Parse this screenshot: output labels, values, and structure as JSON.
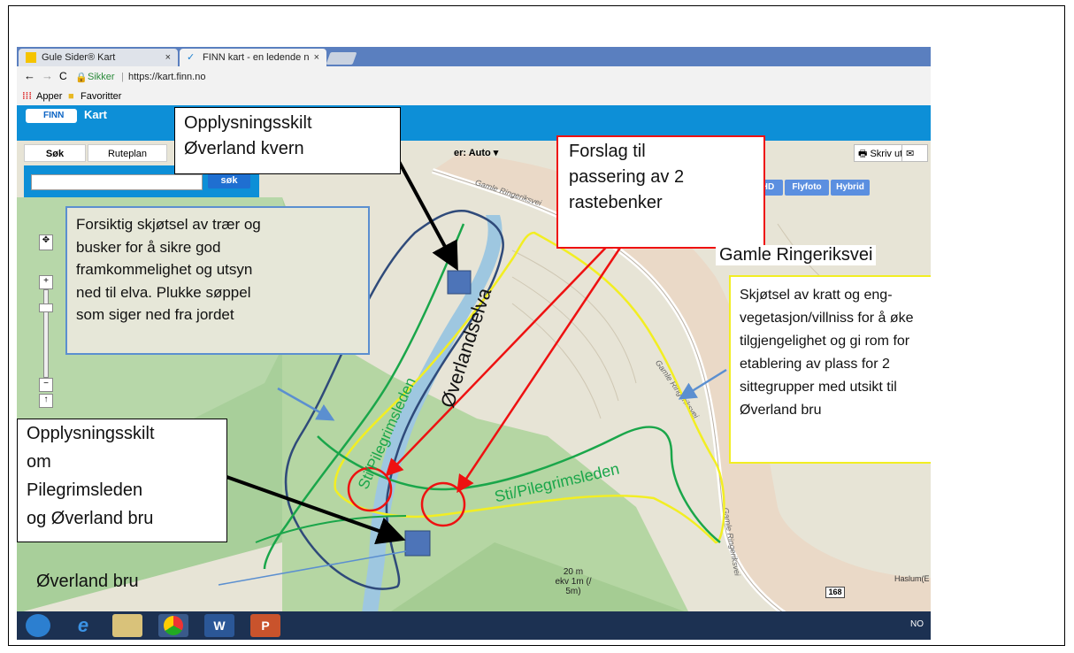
{
  "browser": {
    "tabs": [
      {
        "label": "Gule Sider® Kart",
        "close": "×"
      },
      {
        "label": "FINN kart - en ledende n",
        "close": "×"
      }
    ],
    "nav": {
      "back": "←",
      "forward": "→",
      "reload": "C"
    },
    "secure_label": "Sikker",
    "url": "https://kart.finn.no",
    "bookmarks": [
      "Apper",
      "Favoritter"
    ]
  },
  "finn": {
    "logo": "FINN",
    "title": "Kart",
    "menu": [
      "Søk",
      "Ruteplan"
    ],
    "map_mode_label": "er: Auto ▾",
    "print_label": "Skriv ut",
    "search_button": "søk",
    "map_types": [
      "HD",
      "Flyfoto",
      "Hybrid"
    ],
    "scale_text": [
      "20 m",
      "ekv 1m (/",
      "5m)"
    ],
    "place_label": "Haslum(E",
    "road_number": "168",
    "road_labels": [
      "Gamle Ringeriksvei",
      "Gamle Ringeriksvei",
      "Gamle Ringeriksvei"
    ],
    "zoom": {
      "plus": "+",
      "minus": "−",
      "up": "↑"
    }
  },
  "taskbar": {
    "lang": "NO"
  },
  "annotations": {
    "box1": "Opplysningsskilt\nØverland kvern",
    "box2": "Forsiktig skjøtsel av trær og\nbusker for å sikre god\nframkommelighet og utsyn\nned til elva. Plukke søppel\nsom siger ned fra jordet",
    "box3": "Forslag til\npassering av 2\nrastebenker",
    "box4": "Skjøtsel av kratt og eng-\nvegetasjon/villniss for å øke\ntilgjengelighet og gi rom for\netablering av plass for 2\nsittegrupper med utsikt til\nØverland bru",
    "box5": "Opplysningsskilt\nom\nPilegrimsleden\nog Øverland bru",
    "road_label_big": "Gamle Ringeriksvei",
    "bridge_label": "Øverland bru",
    "river_label": "Øverlandselva",
    "trail_label_1": "Sti/Pilegrimsleden",
    "trail_label_2": "Sti/Pilegrimsleden"
  },
  "colors": {
    "finn_blue": "#0d8fd7",
    "annotation_red": "#e11111",
    "annotation_yellow": "#f2ee22",
    "trail_green": "#1aa64a",
    "annotation_navy": "#2f4a7a"
  }
}
